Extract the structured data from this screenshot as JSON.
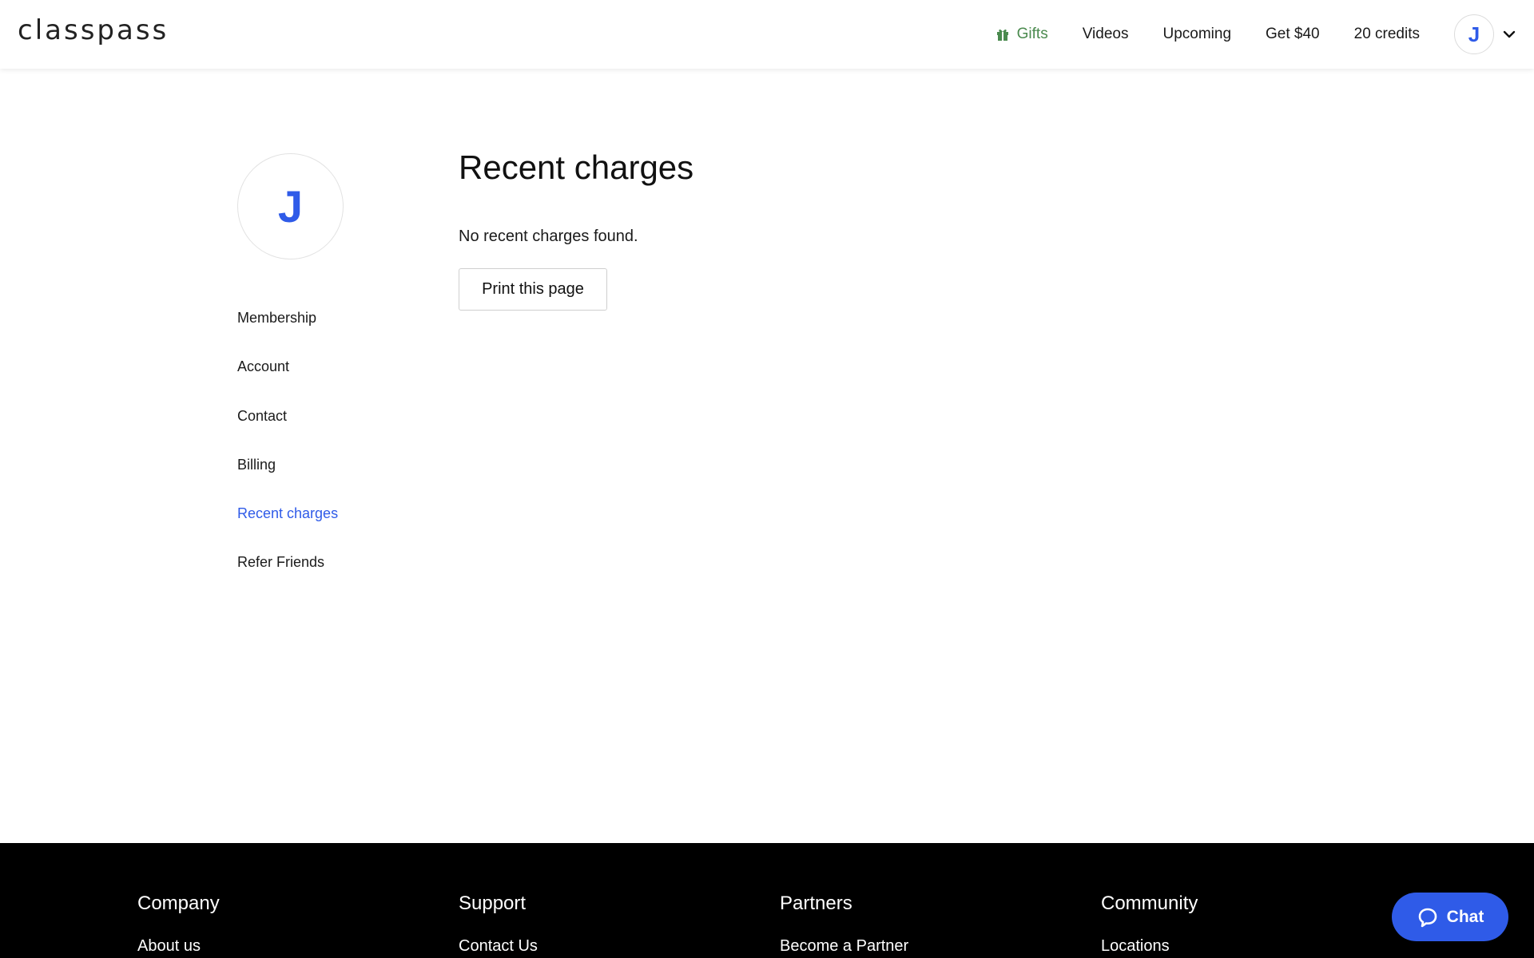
{
  "header": {
    "logo": "classpass",
    "nav": {
      "gifts": "Gifts",
      "videos": "Videos",
      "upcoming": "Upcoming",
      "referral": "Get $40",
      "credits": "20 credits"
    },
    "avatar_initial": "J"
  },
  "sidebar": {
    "avatar_initial": "J",
    "items": [
      {
        "label": "Membership",
        "active": false
      },
      {
        "label": "Account",
        "active": false
      },
      {
        "label": "Contact",
        "active": false
      },
      {
        "label": "Billing",
        "active": false
      },
      {
        "label": "Recent charges",
        "active": true
      },
      {
        "label": "Refer Friends",
        "active": false
      }
    ]
  },
  "main": {
    "title": "Recent charges",
    "empty_message": "No recent charges found.",
    "print_button": "Print this page"
  },
  "footer": {
    "columns": [
      {
        "heading": "Company",
        "link": "About us"
      },
      {
        "heading": "Support",
        "link": "Contact Us"
      },
      {
        "heading": "Partners",
        "link": "Become a Partner"
      },
      {
        "heading": "Community",
        "link": "Locations"
      }
    ]
  },
  "chat": {
    "label": "Chat"
  },
  "colors": {
    "accent": "#2f5be8",
    "gifts": "#4a8a4e",
    "footer_bg": "#000000"
  },
  "icons": [
    "gift-icon",
    "chevron-down-icon",
    "chat-bubble-icon"
  ]
}
